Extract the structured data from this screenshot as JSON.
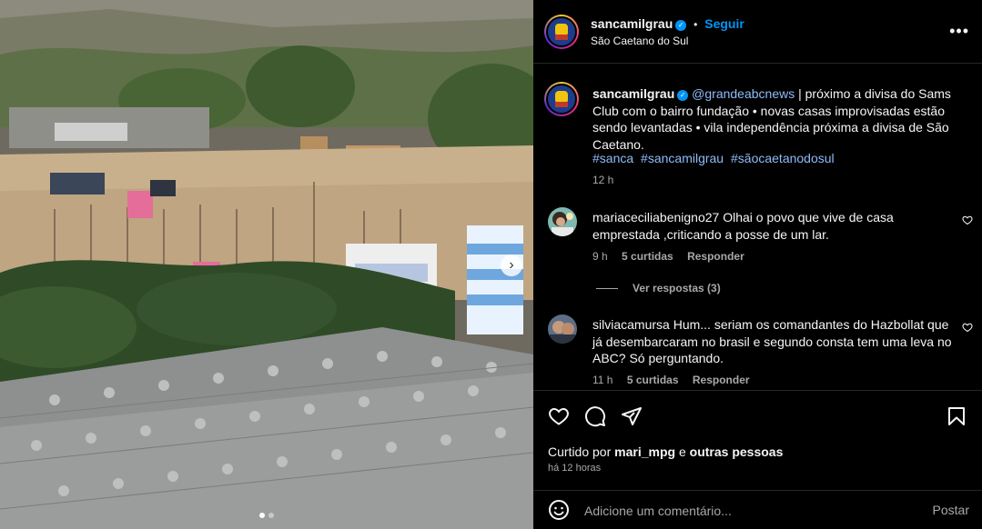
{
  "post": {
    "author": "sancamilgrau",
    "follow_label": "Seguir",
    "location": "São Caetano do Sul",
    "more_label": "•••",
    "caption": {
      "mention": "@grandeabcnews",
      "text": " | próximo a divisa do Sams Club com o bairro fundação • novas casas improvisadas estão sendo levantadas • vila independência próxima a divisa de São Caetano.",
      "hashtags": [
        "#sanca",
        "#sancamilgrau",
        "#sãocaetanodosul"
      ],
      "time": "12 h"
    }
  },
  "comments": [
    {
      "user": "mariaceciliabenigno27",
      "text": "Olhai o povo que vive de casa emprestada ,criticando a posse de um lar.",
      "time": "9 h",
      "likes": "5 curtidas",
      "reply_label": "Responder",
      "view_replies": "Ver respostas (3)"
    },
    {
      "user": "silviacamursa",
      "text": "Hum... seriam os comandantes do Hazbollat que já desembarcaram no brasil e segundo consta tem uma leva no ABC? Só perguntando.",
      "time": "11 h",
      "likes": "5 curtidas",
      "reply_label": "Responder"
    }
  ],
  "likes": {
    "prefix": "Curtido por ",
    "user": "mari_mpg",
    "connector": " e ",
    "others": "outras pessoas",
    "time_ago": "há 12 horas"
  },
  "composer": {
    "placeholder": "Adicione um comentário...",
    "post_label": "Postar"
  },
  "icons": {
    "verified": "verified-badge-icon",
    "like": "heart-icon",
    "comment": "comment-icon",
    "share": "share-icon",
    "save": "bookmark-icon",
    "emoji": "emoji-icon",
    "next": "chevron-right-icon"
  },
  "colors": {
    "accent": "#0095f6",
    "link": "#8fbbf9",
    "muted": "#a8a8a8",
    "background": "#000000",
    "divider": "#262626"
  },
  "carousel": {
    "slide_count": 2,
    "active_slide": 1
  }
}
